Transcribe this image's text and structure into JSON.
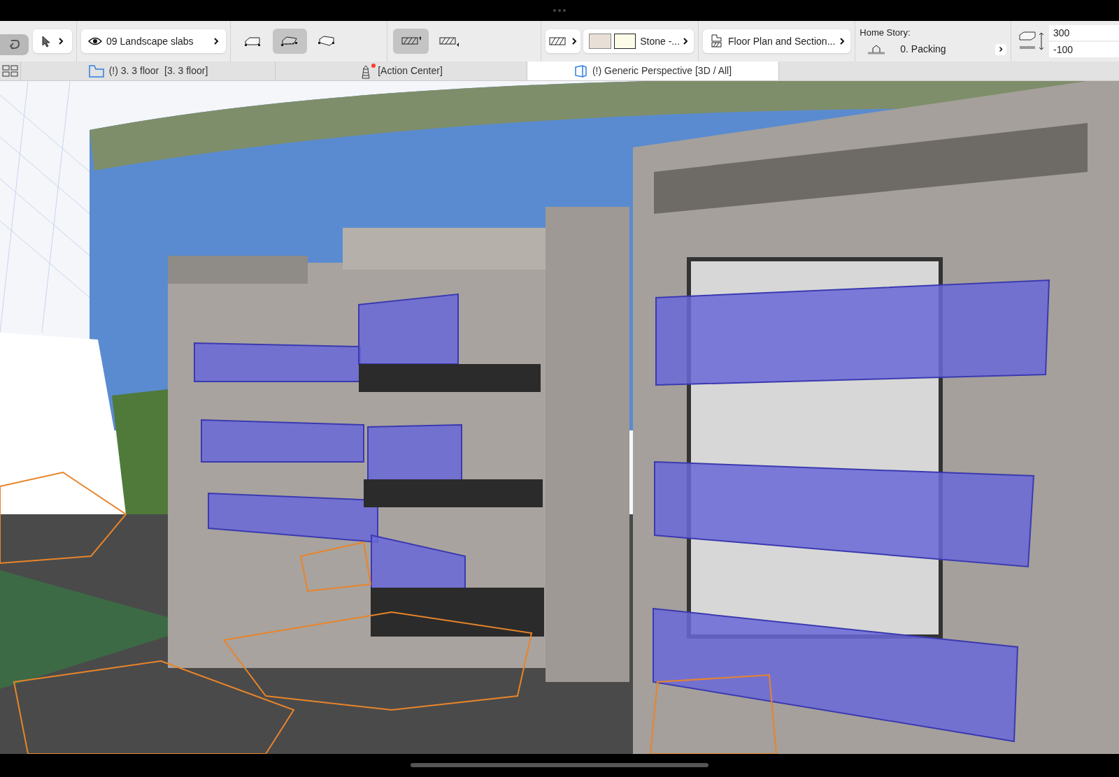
{
  "toolbar": {
    "layer": {
      "label": "09 Landscape slabs"
    },
    "geometry_methods": [
      {
        "selected": false
      },
      {
        "selected": true
      },
      {
        "selected": false
      }
    ],
    "construction_methods": [
      {
        "selected": true
      },
      {
        "selected": false
      }
    ],
    "surface": {
      "label": "Stone -..."
    },
    "view_setting": {
      "label": "Floor Plan and Section..."
    },
    "home_story": {
      "title": "Home Story:",
      "value": "0. Packing"
    },
    "elevations": [
      "300",
      "-100"
    ]
  },
  "tabs": [
    {
      "kind": "plan",
      "label": "(!) 3. 3 floor  [3. 3 floor]",
      "selected": false,
      "notification": false
    },
    {
      "kind": "action",
      "label": "[Action Center]",
      "selected": false,
      "notification": true
    },
    {
      "kind": "perspective",
      "label": "(!) Generic Perspective [3D / All]",
      "selected": true,
      "notification": false
    }
  ]
}
